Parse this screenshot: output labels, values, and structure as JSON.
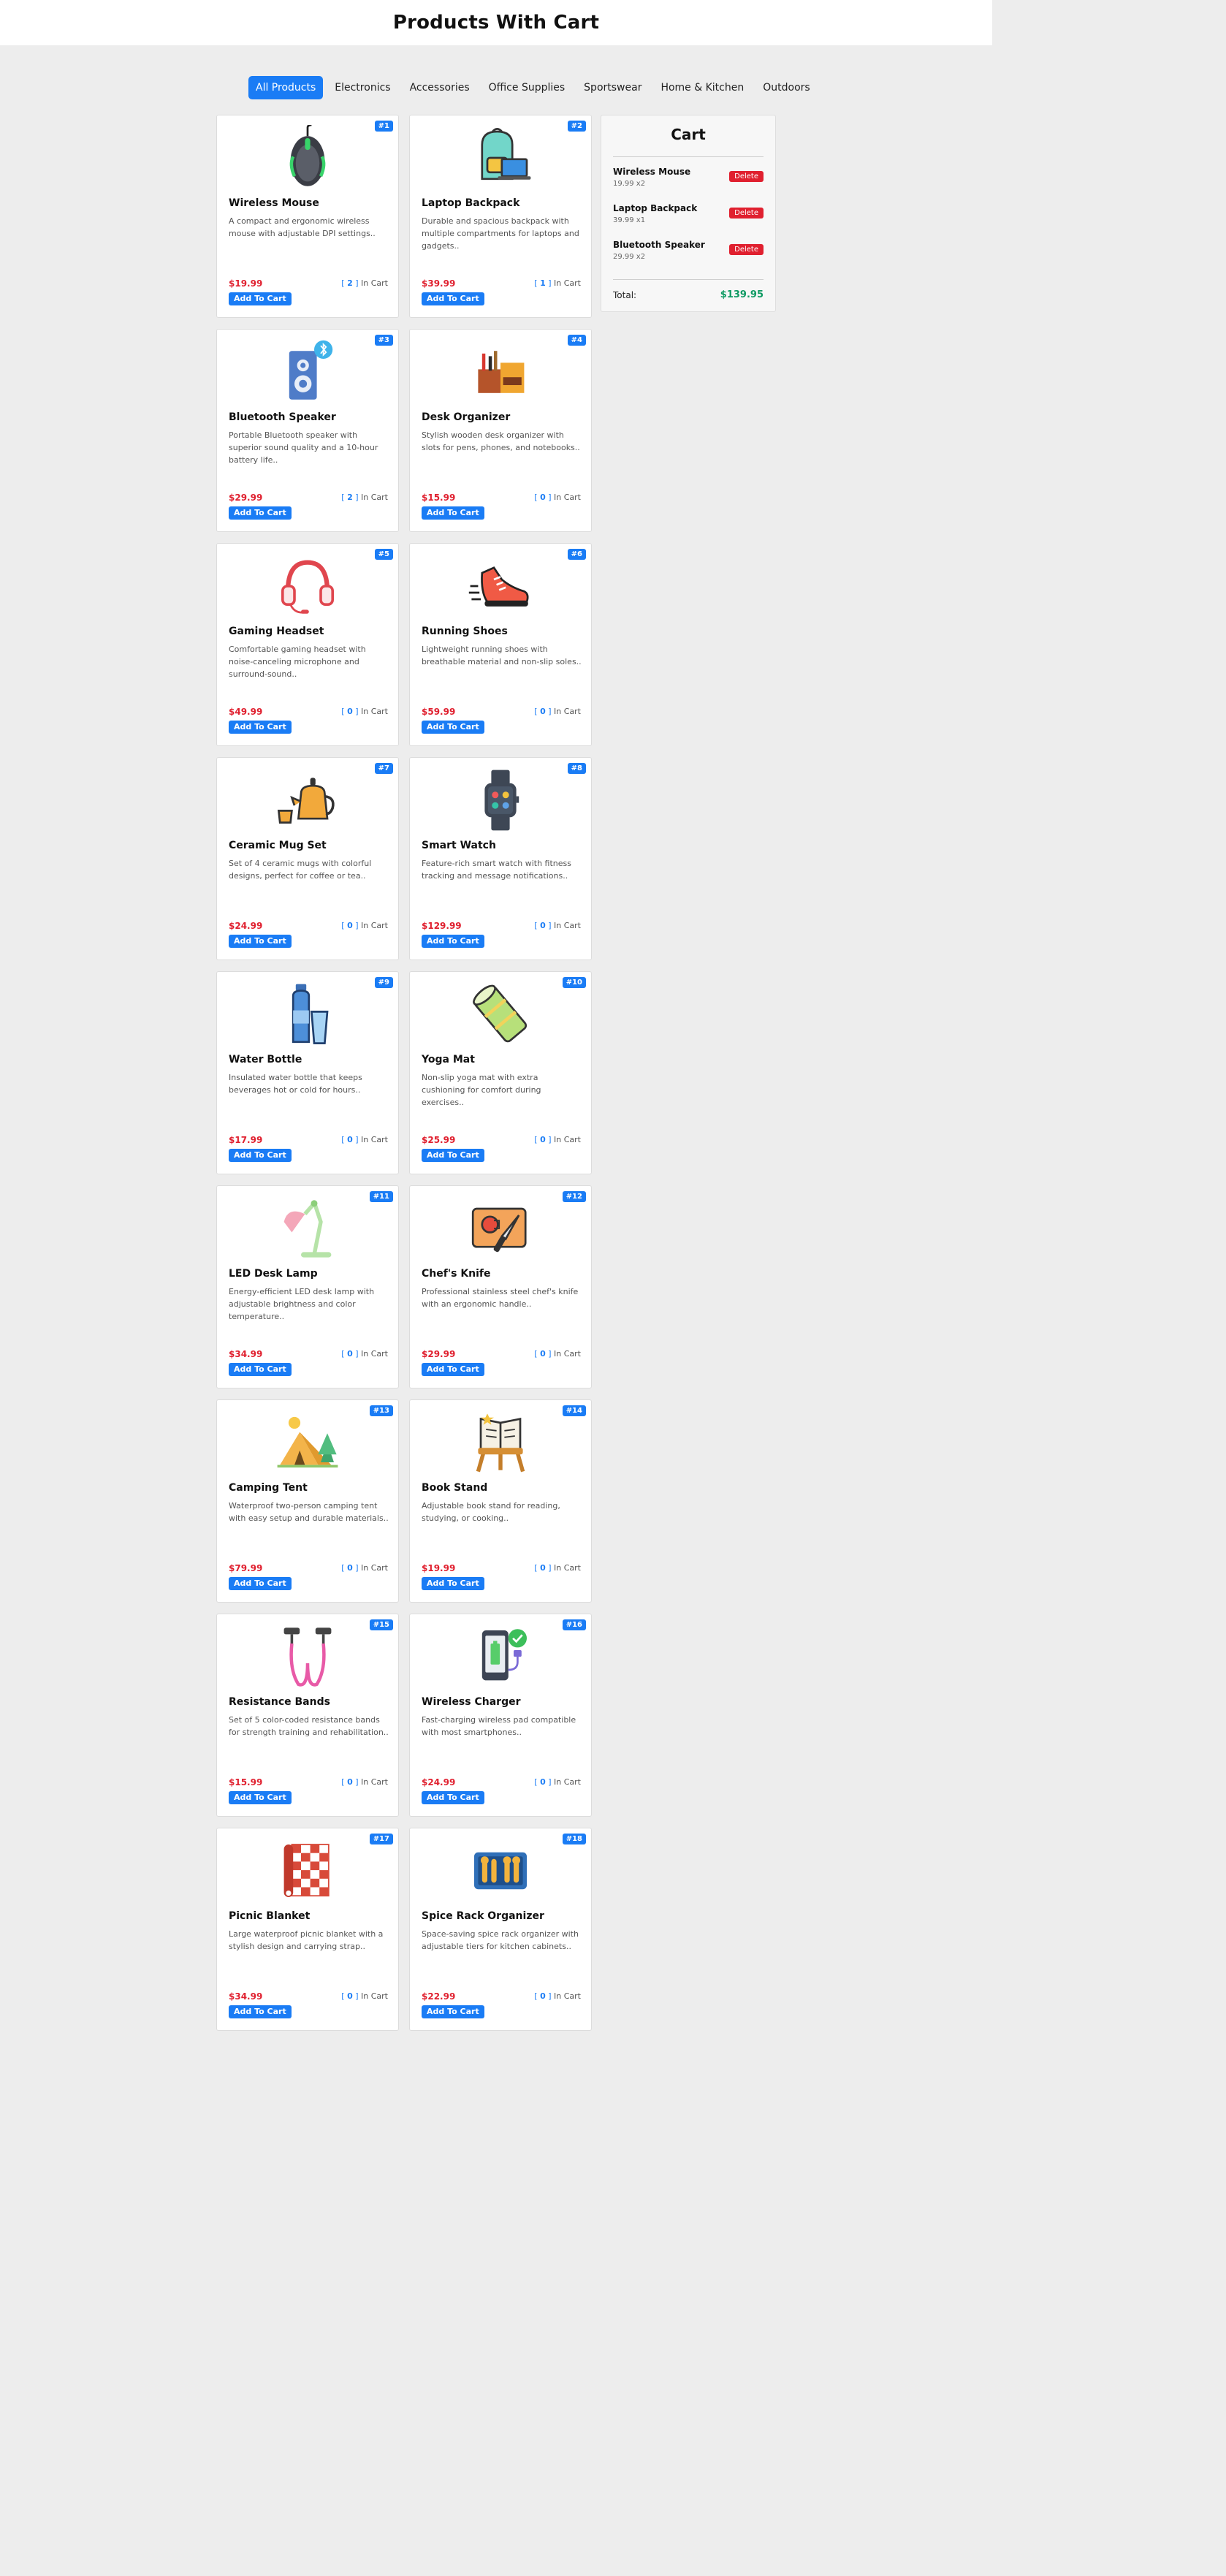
{
  "header": {
    "title": "Products With Cart"
  },
  "tabs": [
    {
      "label": "All Products",
      "active": true
    },
    {
      "label": "Electronics"
    },
    {
      "label": "Accessories"
    },
    {
      "label": "Office Supplies"
    },
    {
      "label": "Sportswear"
    },
    {
      "label": "Home & Kitchen"
    },
    {
      "label": "Outdoors"
    }
  ],
  "card_labels": {
    "add_to_cart": "Add To Cart",
    "in_cart": "In Cart"
  },
  "products": [
    {
      "badge": "#1",
      "name": "Wireless Mouse",
      "desc": "A compact and ergonomic wireless mouse with adjustable DPI settings..",
      "price": "$19.99",
      "count": "2",
      "icon": "mouse-icon"
    },
    {
      "badge": "#2",
      "name": "Laptop Backpack",
      "desc": "Durable and spacious backpack with multiple compartments for laptops and gadgets..",
      "price": "$39.99",
      "count": "1",
      "icon": "backpack-icon"
    },
    {
      "badge": "#3",
      "name": "Bluetooth Speaker",
      "desc": "Portable Bluetooth speaker with superior sound quality and a 10-hour battery life..",
      "price": "$29.99",
      "count": "2",
      "icon": "speaker-icon"
    },
    {
      "badge": "#4",
      "name": "Desk Organizer",
      "desc": "Stylish wooden desk organizer with slots for pens, phones, and notebooks..",
      "price": "$15.99",
      "count": "0",
      "icon": "organizer-icon"
    },
    {
      "badge": "#5",
      "name": "Gaming Headset",
      "desc": "Comfortable gaming headset with noise-canceling microphone and surround-sound..",
      "price": "$49.99",
      "count": "0",
      "icon": "headset-icon"
    },
    {
      "badge": "#6",
      "name": "Running Shoes",
      "desc": "Lightweight running shoes with breathable material and non-slip soles..",
      "price": "$59.99",
      "count": "0",
      "icon": "shoe-icon"
    },
    {
      "badge": "#7",
      "name": "Ceramic Mug Set",
      "desc": "Set of 4 ceramic mugs with colorful designs, perfect for coffee or tea..",
      "price": "$24.99",
      "count": "0",
      "icon": "teapot-icon"
    },
    {
      "badge": "#8",
      "name": "Smart Watch",
      "desc": "Feature-rich smart watch with fitness tracking and message notifications..",
      "price": "$129.99",
      "count": "0",
      "icon": "smartwatch-icon"
    },
    {
      "badge": "#9",
      "name": "Water Bottle",
      "desc": "Insulated water bottle that keeps beverages hot or cold for hours..",
      "price": "$17.99",
      "count": "0",
      "icon": "bottle-icon"
    },
    {
      "badge": "#10",
      "name": "Yoga Mat",
      "desc": "Non-slip yoga mat with extra cushioning for comfort during exercises..",
      "price": "$25.99",
      "count": "0",
      "icon": "yoga-mat-icon"
    },
    {
      "badge": "#11",
      "name": "LED Desk Lamp",
      "desc": "Energy-efficient LED desk lamp with adjustable brightness and color temperature..",
      "price": "$34.99",
      "count": "0",
      "icon": "lamp-icon"
    },
    {
      "badge": "#12",
      "name": "Chef's Knife",
      "desc": "Professional stainless steel chef's knife with an ergonomic handle..",
      "price": "$29.99",
      "count": "0",
      "icon": "knife-icon"
    },
    {
      "badge": "#13",
      "name": "Camping Tent",
      "desc": "Waterproof two-person camping tent with easy setup and durable materials..",
      "price": "$79.99",
      "count": "0",
      "icon": "tent-icon"
    },
    {
      "badge": "#14",
      "name": "Book Stand",
      "desc": "Adjustable book stand for reading, studying, or cooking..",
      "price": "$19.99",
      "count": "0",
      "icon": "book-stand-icon"
    },
    {
      "badge": "#15",
      "name": "Resistance Bands",
      "desc": "Set of 5 color-coded resistance bands for strength training and rehabilitation..",
      "price": "$15.99",
      "count": "0",
      "icon": "resistance-band-icon"
    },
    {
      "badge": "#16",
      "name": "Wireless Charger",
      "desc": "Fast-charging wireless pad compatible with most smartphones..",
      "price": "$24.99",
      "count": "0",
      "icon": "charger-icon"
    },
    {
      "badge": "#17",
      "name": "Picnic Blanket",
      "desc": "Large waterproof picnic blanket with a stylish design and carrying strap..",
      "price": "$34.99",
      "count": "0",
      "icon": "blanket-icon"
    },
    {
      "badge": "#18",
      "name": "Spice Rack Organizer",
      "desc": "Space-saving spice rack organizer with adjustable tiers for kitchen cabinets..",
      "price": "$22.99",
      "count": "0",
      "icon": "spice-rack-icon"
    }
  ],
  "cart": {
    "title": "Cart",
    "delete_label": "Delete",
    "items": [
      {
        "name": "Wireless Mouse",
        "meta": "19.99 x2"
      },
      {
        "name": "Laptop Backpack",
        "meta": "39.99 x1"
      },
      {
        "name": "Bluetooth Speaker",
        "meta": "29.99 x2"
      }
    ],
    "total_label": "Total:",
    "total_value": "$139.95"
  },
  "colors": {
    "accent": "#1a7cf5",
    "price": "#e0202f",
    "total": "#0f9a63",
    "delete": "#e0202f"
  }
}
